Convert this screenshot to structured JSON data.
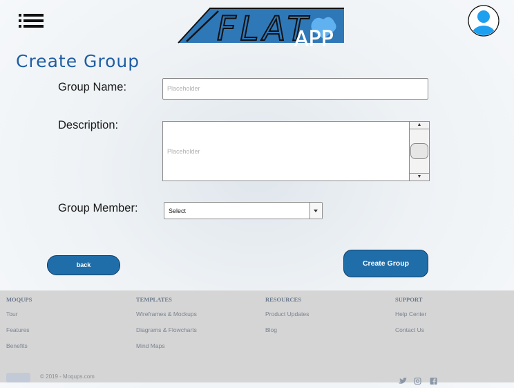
{
  "header": {
    "menu_icon": "hamburger-list-icon",
    "logo": {
      "text": "FLAT",
      "badge": "APP"
    },
    "avatar_icon": "user-avatar-icon"
  },
  "page_title": "Create Group",
  "form": {
    "group_name": {
      "label": "Group Name:",
      "placeholder": "Placeholder"
    },
    "description": {
      "label": "Description:",
      "placeholder": "Placeholder"
    },
    "group_member": {
      "label": "Group Member:",
      "selected": "Select"
    }
  },
  "buttons": {
    "back": "back",
    "create": "Create Group"
  },
  "footer": {
    "columns": [
      {
        "title": "MOQUPS",
        "links": [
          "Tour",
          "Features",
          "Benefits"
        ]
      },
      {
        "title": "TEMPLATES",
        "links": [
          "Wireframes & Mockups",
          "Diagrams & Flowcharts",
          "Mind Maps"
        ]
      },
      {
        "title": "RESOURCES",
        "links": [
          "Product Updates",
          "Blog"
        ]
      },
      {
        "title": "SUPPORT",
        "links": [
          "Help Center",
          "Contact Us"
        ]
      }
    ],
    "copyright": "© 2019 - Moqups.com",
    "social_icons": [
      "twitter-icon",
      "instagram-icon",
      "facebook-icon"
    ]
  },
  "colors": {
    "accent": "#1f6eaa",
    "title": "#1f5ea4",
    "footer_bg": "#d5d5d5"
  }
}
